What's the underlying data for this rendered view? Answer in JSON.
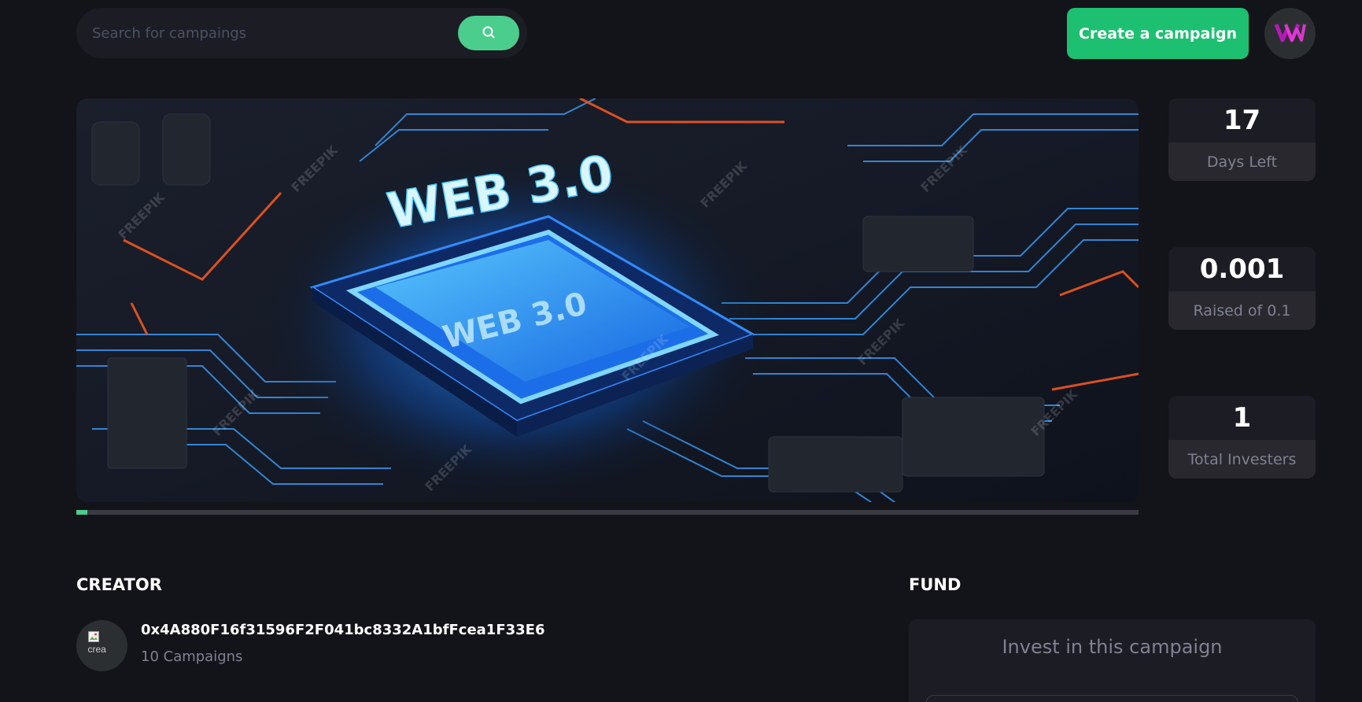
{
  "header": {
    "search_placeholder": "Search for campaings",
    "create_label": "Create a campaign"
  },
  "hero": {
    "image_text_large": "WEB 3.0",
    "image_text_small": "WEB 3.0",
    "watermark": "FREEPIK",
    "progress": 0.01
  },
  "stats": [
    {
      "value": "17",
      "label": "Days Left"
    },
    {
      "value": "0.001",
      "label": "Raised of 0.1"
    },
    {
      "value": "1",
      "label": "Total Investers"
    }
  ],
  "creator": {
    "title": "CREATOR",
    "address": "0x4A880F16f31596F2F041bc8332A1bfFcea1F33E6",
    "campaigns": "10 Campaigns",
    "avatar_alt": "crea"
  },
  "fund": {
    "title": "FUND",
    "heading": "Invest in this campaign"
  },
  "colors": {
    "background": "#13131a",
    "card": "#1c1c24",
    "accent": "#4acd8d",
    "button": "#1dc071",
    "muted": "#808191"
  }
}
